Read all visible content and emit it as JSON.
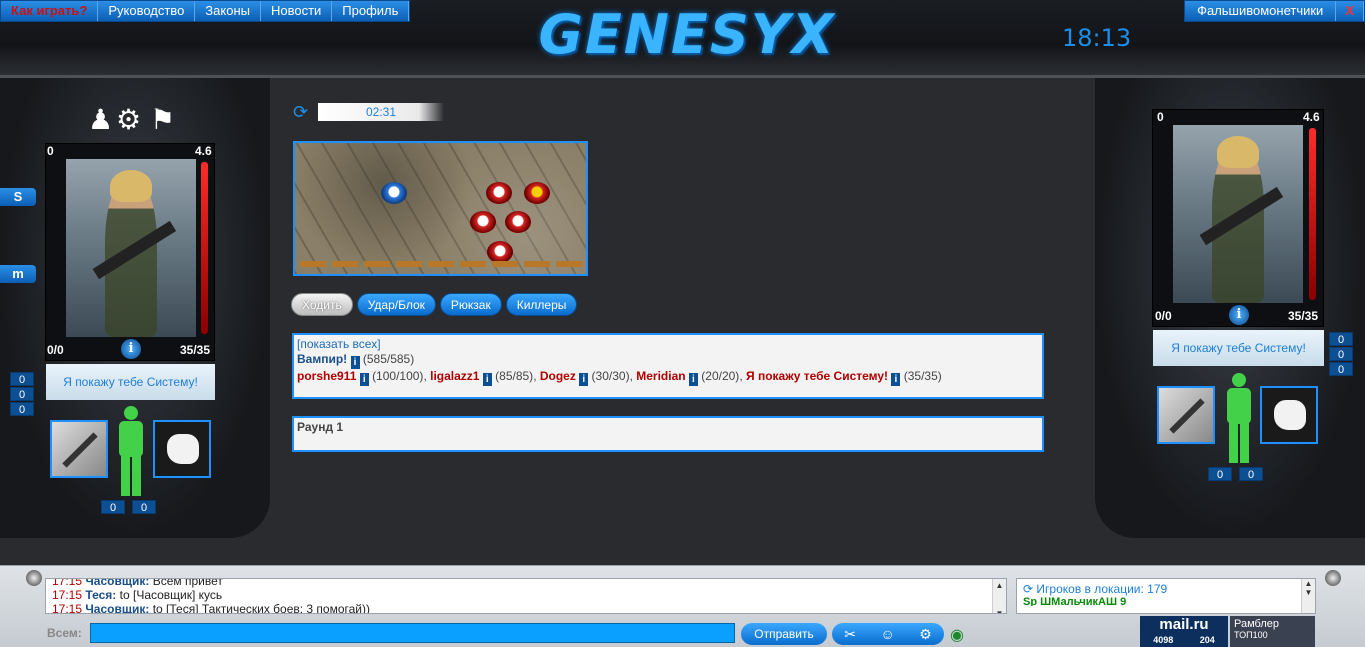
{
  "nav": {
    "items": [
      "Как играть?",
      "Руководство",
      "Законы",
      "Новости",
      "Профиль"
    ],
    "right_items": [
      "Фальшивомонетчики",
      "X"
    ]
  },
  "header": {
    "logo": "GENESYX",
    "clock": "18:13"
  },
  "left_player": {
    "stat_left": "0",
    "stat_right": "4.6",
    "counter_left": "0/0",
    "counter_right": "35/35",
    "name": "Я покажу тебе Систему!",
    "side_counts": [
      "0",
      "0",
      "0"
    ],
    "bottom_counts": [
      "0",
      "0"
    ],
    "hp_fraction": 1.0
  },
  "right_player": {
    "stat_left": "0",
    "stat_right": "4.6",
    "counter_left": "0/0",
    "counter_right": "35/35",
    "name": "Я покажу тебе Систему!",
    "side_counts": [
      "0",
      "0",
      "0"
    ],
    "bottom_counts": [
      "0",
      "0"
    ],
    "hp_fraction": 1.0
  },
  "side_icons": [
    "S",
    "m"
  ],
  "battle": {
    "timer": "02:31",
    "tabs": [
      "Ходить",
      "Удар/Блок",
      "Рюкзак",
      "Киллеры"
    ],
    "show_all": "[показать всех]",
    "team_blue": {
      "name": "Вампир!",
      "hp": "(585/585)"
    },
    "team_red": [
      {
        "name": "porshe911",
        "hp": "(100/100)"
      },
      {
        "name": "ligalazz1",
        "hp": "(85/85)"
      },
      {
        "name": "Dogez",
        "hp": "(30/30)"
      },
      {
        "name": "Meridian",
        "hp": "(20/20)"
      },
      {
        "name": "Я покажу тебе Систему!",
        "hp": "(35/35)"
      }
    ],
    "round": "Раунд 1"
  },
  "chat": {
    "lines": [
      {
        "time": "17:15",
        "nick": "Часовщик:",
        "text": "Всем привет"
      },
      {
        "time": "17:15",
        "nick": "Теся:",
        "text": "to [Часовщик] кусь"
      },
      {
        "time": "17:15",
        "nick": "Часовщик:",
        "text": "to [Теся] Тактических боев: 3 помогай))"
      }
    ],
    "online_label": "Игроков в локации: 179",
    "online_row": "Sp ШМальчикАШ 9",
    "input_label": "Всем:",
    "send_label": "Отправить",
    "counter_logo": "mail.ru",
    "counter_a": "4098",
    "counter_b": "204",
    "rambler": "Рамблер",
    "rambler_sub": "ТОП100"
  }
}
